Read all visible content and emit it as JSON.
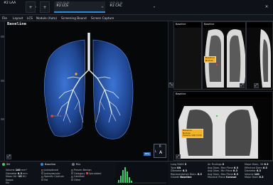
{
  "tabs": [
    {
      "date": "",
      "name": "#2 LAA",
      "active": false
    },
    {
      "date": "1975.01.01",
      "name": "#2 LCS",
      "active": true
    },
    {
      "date": "1975.01.01",
      "name": "#2 CAC",
      "active": false
    }
  ],
  "tab_chevron": "▾",
  "tab_plus": "+",
  "menu": [
    "File",
    "Layout",
    "LCS",
    "Nodule (Auto)",
    "Screening Bound",
    "Screen Capture"
  ],
  "main": {
    "title": "Baseline",
    "badge": "BPG",
    "pad_top": "R",
    "pad_left": "L",
    "pad_bottom": "A"
  },
  "right_panes": {
    "top_left_label": "Baseline",
    "top_right_label": "Baseline",
    "bottom_label": "Baseline",
    "nodule_label_lines": [
      "Baseline",
      "Nodule",
      "Volume 140 mm3"
    ]
  },
  "bottom_panel": {
    "nodule_id": "SN",
    "series_tag": "Baseline",
    "location_tag": "RLL",
    "metrics": [
      {
        "label": "Volume",
        "value": "140",
        "unit": "mm³"
      },
      {
        "label": "Diameter",
        "value": "6.3",
        "unit": "mm"
      },
      {
        "label": "Mean HU",
        "value": "-15",
        "unit": "HU"
      },
      {
        "label": "Kappa",
        "value": "",
        "unit": ""
      },
      {
        "label": "Etc",
        "value": "",
        "unit": ""
      }
    ],
    "checklist": [
      "Juxtapleural",
      "Juxtavascular",
      "Specific Calcium",
      "Fat"
    ],
    "categories": [
      "Proven Benign",
      "Category",
      "Calcified",
      "Other"
    ],
    "category_extra": "Spiculated",
    "lungrads": [
      {
        "label": "Lung RADS",
        "value": "3"
      },
      {
        "label": "Type",
        "value": "SN"
      },
      {
        "label": "Diameter",
        "value": "6.3"
      },
      {
        "label": "Representative Diam.",
        "value": "6.3"
      },
      {
        "label": "Growth",
        "value": "Baseline"
      }
    ],
    "findings": [
      {
        "label": "Air Findings",
        "value": "0"
      },
      {
        "label": "Avg Diam, Max Plane",
        "value": "6.3"
      },
      {
        "label": "Avg Diam, Min Plane",
        "value": "6.3"
      },
      {
        "label": "Avg Diam, Max Plane",
        "value": "6.3"
      },
      {
        "label": "Maximal Plane",
        "value": "Coronal"
      }
    ],
    "extra": [
      {
        "label": "Major Diam, 3D",
        "value": "6.3"
      },
      {
        "label": "Effective Diam",
        "value": "6.3"
      },
      {
        "label": "Diameter",
        "value": "6.3"
      },
      {
        "label": "Volume",
        "value": "140"
      },
      {
        "label": "Major Diam",
        "value": "6.3"
      }
    ]
  },
  "colors": {
    "accent": "#2f8bd6",
    "lung": "#2f63c9",
    "airway": "#e8eef5",
    "marker": "#f2b32a",
    "nodule_red": "#e23c3c",
    "nodule_green": "#3bd16f"
  }
}
